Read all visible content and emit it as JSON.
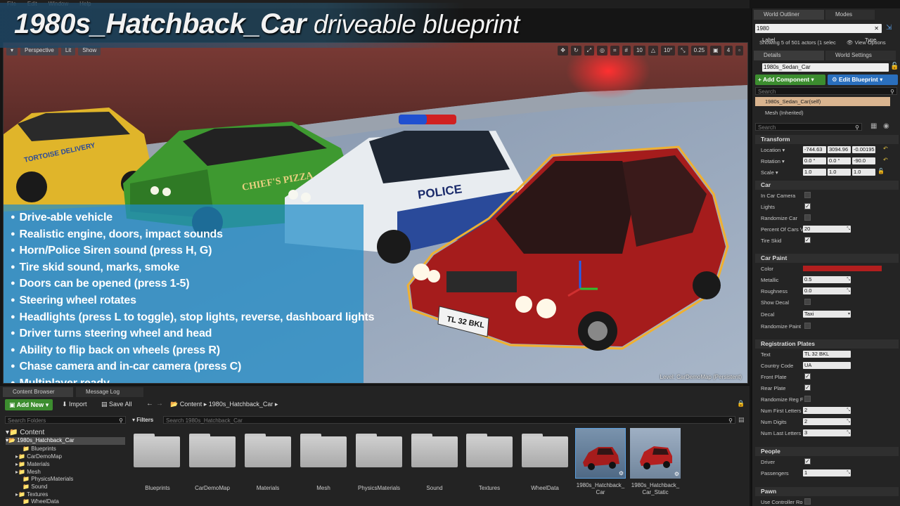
{
  "menubar": {
    "items": [
      "File",
      "Edit",
      "Window",
      "Help"
    ]
  },
  "title": {
    "bold": "1980s_Hatchback_Car",
    "rest": "driveable blueprint"
  },
  "viewport": {
    "toolbar_left": [
      "▾",
      "Perspective",
      "Lit",
      "Show"
    ],
    "toolbar_right_values": [
      "10",
      "10°",
      "0.25",
      "4"
    ],
    "level_label": "Level:  CarDemoMap (Persistent)",
    "features": [
      "Drive-able vehicle",
      "Realistic engine, doors, impact sounds",
      "Horn/Police Siren sound (press H, G)",
      "Tire skid sound, marks, smoke",
      "Doors can be opened (press 1-5)",
      "Steering wheel rotates",
      "Headlights (press L to toggle), stop lights, reverse, dashboard lights",
      "Driver turns steering wheel and head",
      "Ability to flip back on wheels (press R)",
      "Chase camera and in-car camera (press C)",
      "Multiplayer ready"
    ],
    "car_texts": {
      "delivery": "TORTOISE DELIVERY",
      "pizza": "CHIEF'S PIZZA",
      "police": "POLICE",
      "plate": "TL 32 BKL"
    }
  },
  "outliner": {
    "tab_outliner": "World Outliner",
    "tab_modes": "Modes",
    "search_value": "1980",
    "col_label": "Label",
    "col_type": "Type",
    "status": "Showing 5 of 501 actors (1 selec",
    "view_options": "View Options"
  },
  "details": {
    "tab_details": "Details",
    "tab_world": "World Settings",
    "actor_name": "1980s_Sedan_Car",
    "add_component": "+ Add Component",
    "edit_blueprint": "Edit Blueprint",
    "search_placeholder": "Search",
    "self_item": "1980s_Sedan_Car(self)",
    "mesh_item": "Mesh (Inherited)",
    "search2_placeholder": "Search",
    "transform": {
      "title": "Transform",
      "location_label": "Location",
      "location": [
        "-744.63",
        "3094.96",
        "-0.00195"
      ],
      "rotation_label": "Rotation",
      "rotation": [
        "0.0 °",
        "0.0 °",
        "-90.0"
      ],
      "scale_label": "Scale",
      "scale": [
        "1.0",
        "1.0",
        "1.0"
      ]
    },
    "car": {
      "title": "Car",
      "in_car_camera": "In Car Camera",
      "lights": "Lights",
      "randomize_car": "Randomize Car",
      "percent_cars": "Percent Of Cars V",
      "percent_value": "20",
      "tire_skid": "Tire Skid"
    },
    "car_paint": {
      "title": "Car Paint",
      "color": "Color",
      "color_value": "#b21e1e",
      "metallic": "Metallic",
      "metallic_value": "0.5",
      "roughness": "Roughness",
      "roughness_value": "0.0",
      "show_decal": "Show Decal",
      "decal": "Decal",
      "decal_value": "Taxi",
      "randomize_paint": "Randomize Paint"
    },
    "plates": {
      "title": "Registration Plates",
      "text": "Text",
      "text_value": "TL 32 BKL",
      "country": "Country Code",
      "country_value": "UA",
      "front": "Front Plate",
      "rear": "Rear Plate",
      "randomize_reg": "Randomize Reg F",
      "num_first": "Num First Letters",
      "num_first_value": "2",
      "num_digits": "Num Digits",
      "num_digits_value": "2",
      "num_last": "Num Last Letters",
      "num_last_value": "3"
    },
    "people": {
      "title": "People",
      "driver": "Driver",
      "passengers": "Passengers",
      "passengers_value": "1"
    },
    "pawn": {
      "title": "Pawn",
      "use_controller": "Use Controller Ro"
    }
  },
  "bottom": {
    "tab_content": "Content Browser",
    "tab_log": "Message Log",
    "add_new": "Add New",
    "import": "Import",
    "save_all": "Save All",
    "path_root": "Content",
    "path_folder": "1980s_Hatchback_Car",
    "search_folders": "Search Folders",
    "filters": "Filters",
    "search_assets": "Search 1980s_Hatchback_Car",
    "tree": {
      "root": "Content",
      "selected": "1980s_Hatchback_Car",
      "children": [
        "Blueprints",
        "CarDemoMap",
        "Materials",
        "Mesh",
        "PhysicsMaterials",
        "Sound",
        "Textures",
        "WheelData"
      ]
    },
    "assets": [
      "Blueprints",
      "CarDemoMap",
      "Materials",
      "Mesh",
      "PhysicsMaterials",
      "Sound",
      "Textures",
      "WheelData"
    ],
    "blueprint_assets": [
      "1980s_Hatchback_\nCar",
      "1980s_Hatchback_\nCar_Static"
    ]
  },
  "colors": {
    "accent_blue": "#1e8cc8",
    "green_button": "#3c8d2f",
    "blueprint_button": "#2a6fbd",
    "selection_orange": "#f0b030"
  }
}
